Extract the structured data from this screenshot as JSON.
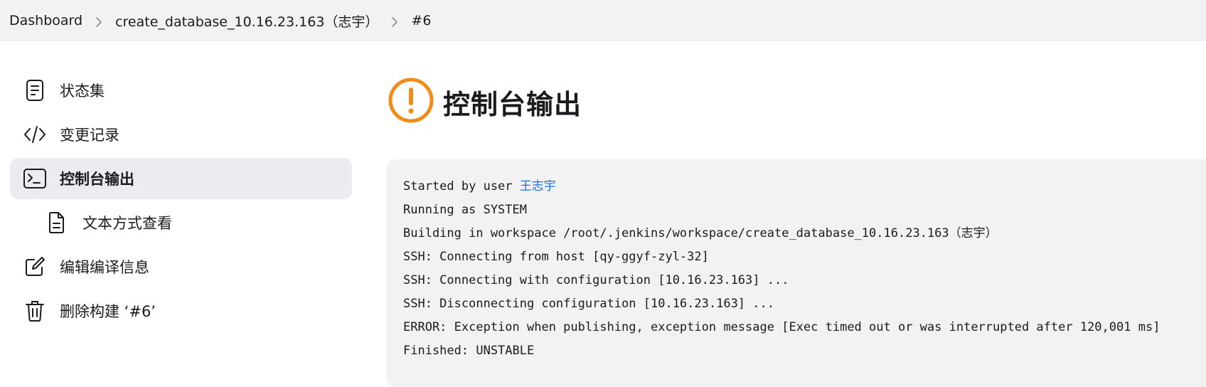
{
  "breadcrumb": {
    "items": [
      "Dashboard",
      "create_database_10.16.23.163（志宇）",
      "#6"
    ]
  },
  "sidebar": {
    "items": [
      {
        "label": "状态集",
        "icon": "document-icon"
      },
      {
        "label": "变更记录",
        "icon": "code-icon"
      },
      {
        "label": "控制台输出",
        "icon": "terminal-icon",
        "active": true
      },
      {
        "label": "文本方式查看",
        "icon": "file-text-icon",
        "sub": true
      },
      {
        "label": "编辑编译信息",
        "icon": "edit-icon"
      },
      {
        "label": "删除构建 ‘#6’",
        "icon": "trash-icon"
      }
    ]
  },
  "main": {
    "title": "控制台输出",
    "status_icon": "warning-icon",
    "status_color": "#f08c1a"
  },
  "console": {
    "started_prefix": "Started by user ",
    "started_user": "王志宇",
    "lines": [
      "Running as SYSTEM",
      "Building in workspace /root/.jenkins/workspace/create_database_10.16.23.163（志宇）",
      "SSH: Connecting from host [qy-ggyf-zyl-32]",
      "SSH: Connecting with configuration [10.16.23.163] ...",
      "SSH: Disconnecting configuration [10.16.23.163] ...",
      "ERROR: Exception when publishing, exception message [Exec timed out or was interrupted after 120,001 ms]",
      "Finished: UNSTABLE"
    ]
  },
  "colors": {
    "link": "#1e6fd9",
    "breadcrumb_bg": "#f2f2f5",
    "active_bg": "#ececf0",
    "console_bg": "#f2f2f2"
  }
}
